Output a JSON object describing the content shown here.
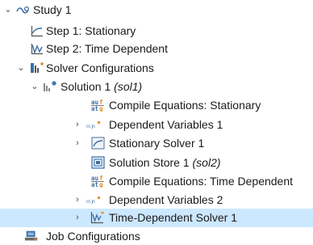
{
  "tree": {
    "study": {
      "label": "Study 1"
    },
    "step1": {
      "label": "Step 1: Stationary"
    },
    "step2": {
      "label": "Step 2: Time Dependent"
    },
    "solver_configs": {
      "label": "Solver Configurations"
    },
    "solution1": {
      "label": "Solution 1 ",
      "tag": "(sol1)"
    },
    "compile_stationary": {
      "label": "Compile Equations: Stationary"
    },
    "dep_vars1": {
      "label": "Dependent Variables 1"
    },
    "stationary_solver": {
      "label": "Stationary Solver 1"
    },
    "solution_store": {
      "label": "Solution Store 1 ",
      "tag": "(sol2)"
    },
    "compile_time": {
      "label": "Compile Equations: Time Dependent"
    },
    "dep_vars2": {
      "label": "Dependent Variables 2"
    },
    "time_solver": {
      "label": "Time-Dependent Solver 1"
    },
    "job_configs": {
      "label": "Job Configurations"
    }
  },
  "icons": {
    "arrow_expanded": "⌄",
    "arrow_collapsed": "›",
    "equations_glyph": "au̶f\nat̶g",
    "variables_glyph": "u,y,"
  },
  "colors": {
    "selection": "#cce8ff",
    "icon_blue": "#3a6ea5",
    "icon_orange": "#e08a1e"
  }
}
